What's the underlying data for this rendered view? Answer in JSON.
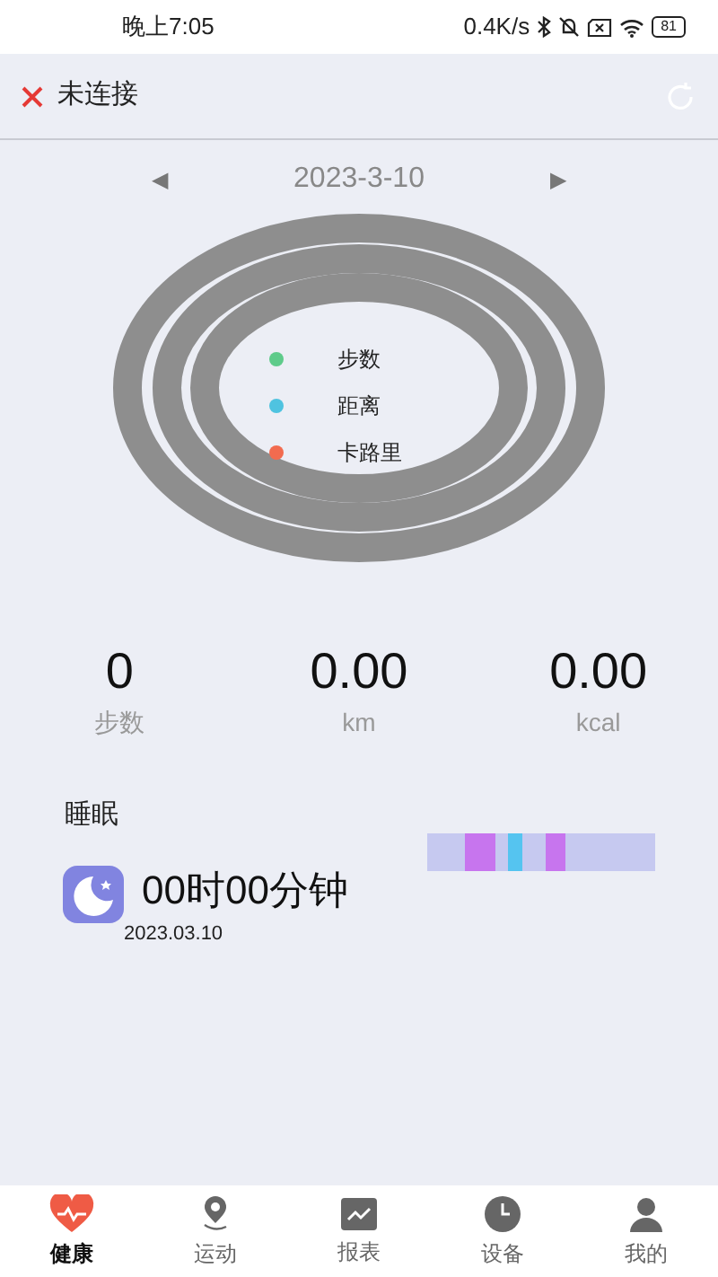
{
  "status_bar": {
    "time": "晚上7:05",
    "speed": "0.4K/s",
    "battery": "81"
  },
  "header": {
    "connection": "未连接"
  },
  "date_nav": {
    "date": "2023-3-10",
    "prev": "◀",
    "next": "▶"
  },
  "rings_legend": [
    {
      "label": "步数",
      "color": "#5ecb8a"
    },
    {
      "label": "距离",
      "color": "#4fc3e0"
    },
    {
      "label": "卡路里",
      "color": "#f26b4f"
    }
  ],
  "stats": [
    {
      "value": "0",
      "unit": "步数"
    },
    {
      "value": "0.00",
      "unit": "km"
    },
    {
      "value": "0.00",
      "unit": "kcal"
    }
  ],
  "sleep": {
    "title": "睡眠",
    "duration": "00时00分钟",
    "date": "2023.03.10"
  },
  "tabs": [
    {
      "label": "健康",
      "selected": true,
      "kind": "heart"
    },
    {
      "label": "运动",
      "selected": false,
      "kind": "pin"
    },
    {
      "label": "报表",
      "selected": false,
      "kind": "chart"
    },
    {
      "label": "设备",
      "selected": false,
      "kind": "clock"
    },
    {
      "label": "我的",
      "selected": false,
      "kind": "user"
    }
  ]
}
